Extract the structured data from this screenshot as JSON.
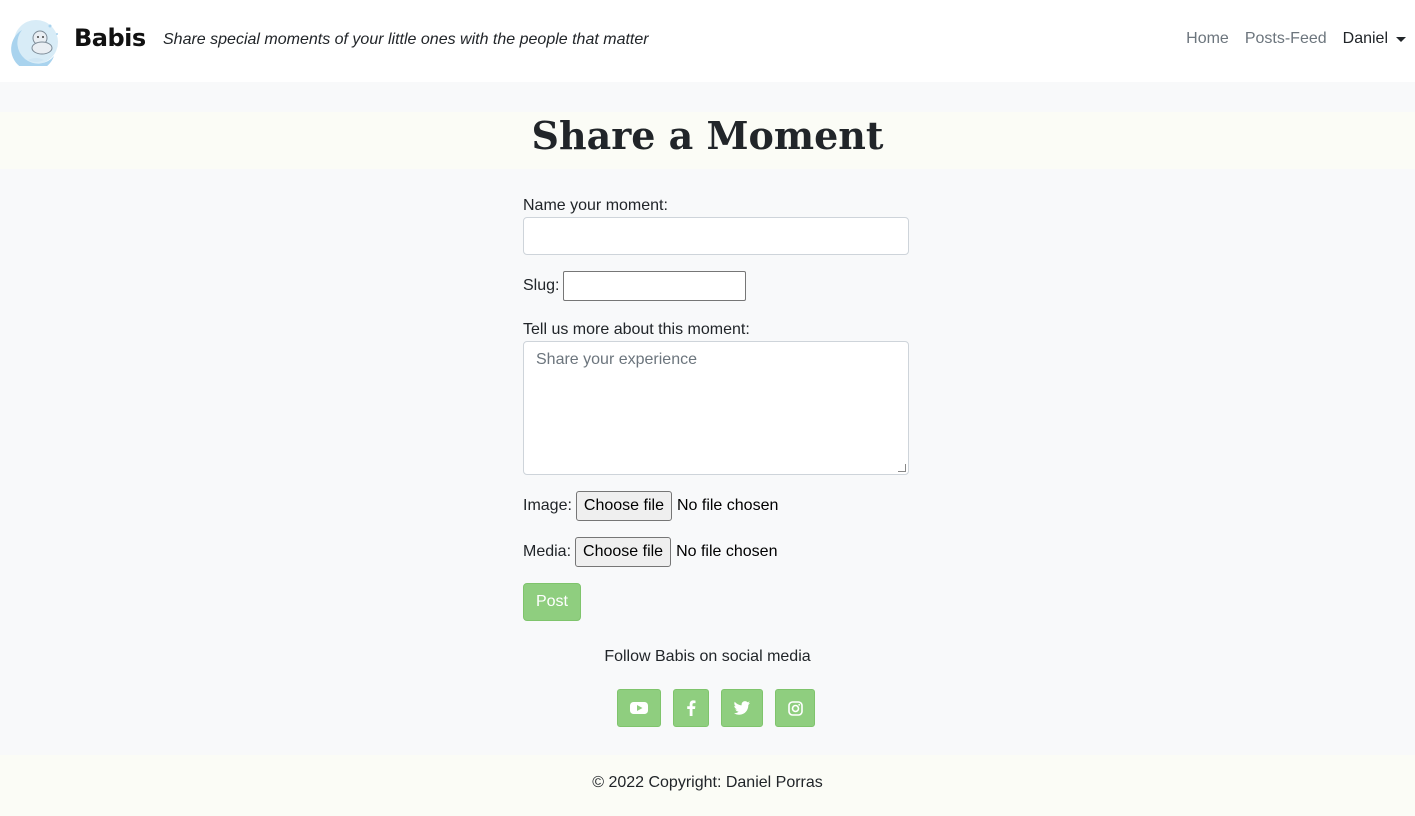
{
  "navbar": {
    "brand": "Babis",
    "tagline": "Share special moments of your little ones with the people that matter",
    "links": [
      "Home",
      "Posts-Feed"
    ],
    "user": "Daniel"
  },
  "page": {
    "title": "Share a Moment"
  },
  "form": {
    "name_label": "Name your moment:",
    "name_value": "",
    "slug_label": "Slug:",
    "slug_value": "",
    "description_label": "Tell us more about this moment:",
    "description_placeholder": "Share your experience",
    "image_label": "Image:",
    "media_label": "Media:",
    "choose_file": "Choose file",
    "no_file": "No file chosen",
    "submit": "Post"
  },
  "social": {
    "heading": "Follow Babis on social media",
    "icons": [
      "youtube-icon",
      "facebook-icon",
      "twitter-icon",
      "instagram-icon"
    ]
  },
  "footer": {
    "copyright": "© 2022 Copyright: Daniel Porras"
  },
  "colors": {
    "accent": "#8fce7f",
    "background": "#f8f9fa",
    "band": "#fbfcf6"
  }
}
